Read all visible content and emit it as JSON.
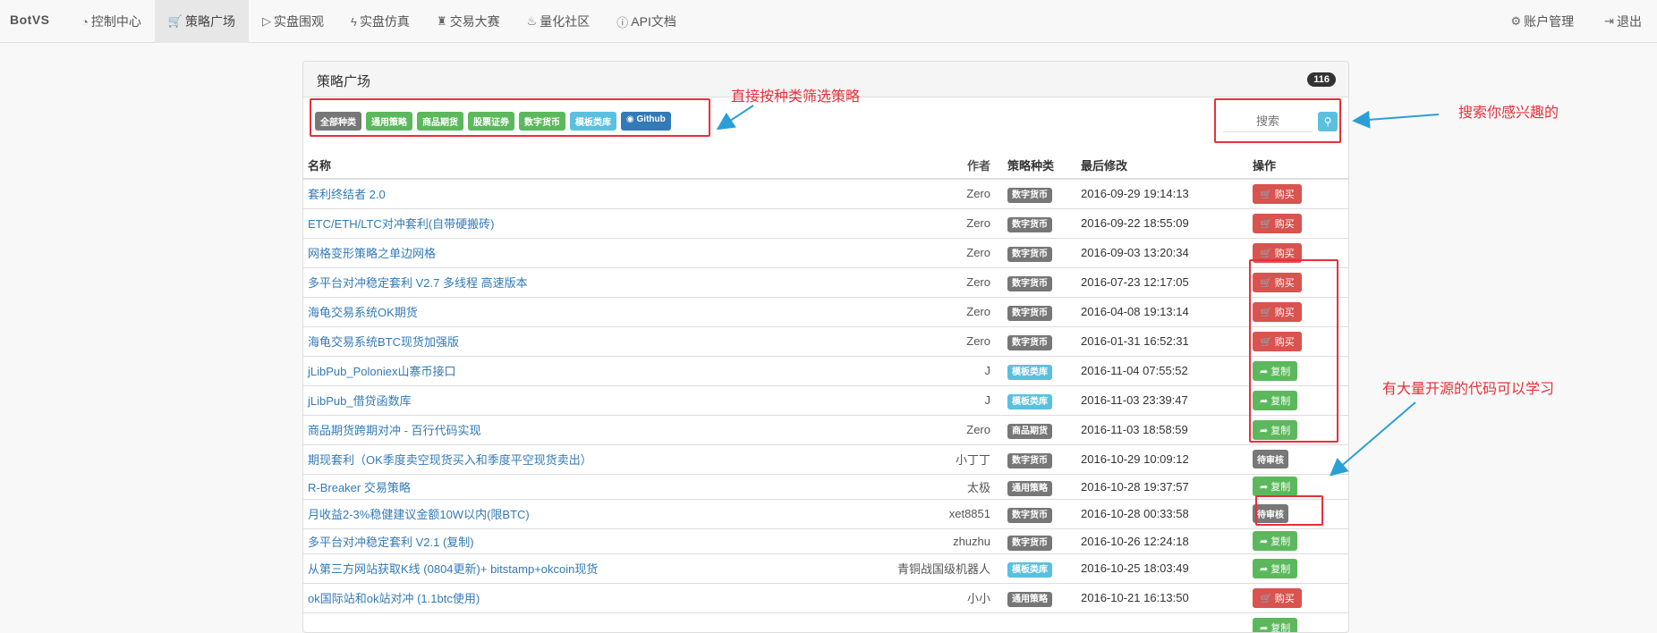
{
  "navbar": {
    "brand": "BotVS",
    "items": [
      {
        "icon": "dashboard-icon",
        "glyph": "◔",
        "label": "控制中心",
        "active": false
      },
      {
        "icon": "cart-icon",
        "glyph": "🛒",
        "label": "策略广场",
        "active": true
      },
      {
        "icon": "play-circle-icon",
        "glyph": "▷",
        "label": "实盘围观",
        "active": false
      },
      {
        "icon": "flash-icon",
        "glyph": "ϟ",
        "label": "实盘仿真",
        "active": false
      },
      {
        "icon": "trophy-icon",
        "glyph": "♜",
        "label": "交易大赛",
        "active": false
      },
      {
        "icon": "fire-icon",
        "glyph": "♨",
        "label": "量化社区",
        "active": false
      },
      {
        "icon": "info-icon",
        "glyph": "ⓘ",
        "label": "API文档",
        "active": false
      }
    ],
    "right_items": [
      {
        "icon": "gear-icon",
        "glyph": "⚙",
        "label": "账户管理"
      },
      {
        "icon": "logout-icon",
        "glyph": "⇥",
        "label": "退出"
      }
    ]
  },
  "panel": {
    "title": "策略广场",
    "count": "116"
  },
  "filters": [
    {
      "label": "全部种类",
      "color": "dark"
    },
    {
      "label": "通用策略",
      "color": "green"
    },
    {
      "label": "商品期货",
      "color": "green"
    },
    {
      "label": "股票证券",
      "color": "green"
    },
    {
      "label": "数字货币",
      "color": "green"
    },
    {
      "label": "模板类库",
      "color": "blue"
    },
    {
      "label": "Github",
      "color": "navy"
    }
  ],
  "search": {
    "placeholder": "搜索"
  },
  "table": {
    "headers": {
      "name": "名称",
      "author": "作者",
      "type": "策略种类",
      "modified": "最后修改",
      "op": "操作"
    },
    "rows": [
      {
        "name": "套利终结者 2.0",
        "author": "Zero",
        "type": "数字货币",
        "type_color": "dark",
        "modified": "2016-09-29 19:14:13",
        "op": "购买",
        "op_kind": "buy"
      },
      {
        "name": "ETC/ETH/LTC对冲套利(自带硬搬砖)",
        "author": "Zero",
        "type": "数字货币",
        "type_color": "dark",
        "modified": "2016-09-22 18:55:09",
        "op": "购买",
        "op_kind": "buy"
      },
      {
        "name": "网格变形策略之单边网格",
        "author": "Zero",
        "type": "数字货币",
        "type_color": "dark",
        "modified": "2016-09-03 13:20:34",
        "op": "购买",
        "op_kind": "buy"
      },
      {
        "name": "多平台对冲稳定套利 V2.7 多线程 高速版本",
        "author": "Zero",
        "type": "数字货币",
        "type_color": "dark",
        "modified": "2016-07-23 12:17:05",
        "op": "购买",
        "op_kind": "buy"
      },
      {
        "name": "海龟交易系统OK期货",
        "author": "Zero",
        "type": "数字货币",
        "type_color": "dark",
        "modified": "2016-04-08 19:13:14",
        "op": "购买",
        "op_kind": "buy"
      },
      {
        "name": "海龟交易系统BTC现货加强版",
        "author": "Zero",
        "type": "数字货币",
        "type_color": "dark",
        "modified": "2016-01-31 16:52:31",
        "op": "购买",
        "op_kind": "buy"
      },
      {
        "name": "jLibPub_Poloniex山寨币接口",
        "author": "J",
        "type": "模板类库",
        "type_color": "blue",
        "modified": "2016-11-04 07:55:52",
        "op": "复制",
        "op_kind": "copy"
      },
      {
        "name": "jLibPub_借贷函数库",
        "author": "J",
        "type": "模板类库",
        "type_color": "blue",
        "modified": "2016-11-03 23:39:47",
        "op": "复制",
        "op_kind": "copy"
      },
      {
        "name": "商品期货跨期对冲 - 百行代码实现",
        "author": "Zero",
        "type": "商品期货",
        "type_color": "dark",
        "modified": "2016-11-03 18:58:59",
        "op": "复制",
        "op_kind": "copy"
      },
      {
        "name": "期现套利（OK季度卖空现货买入和季度平空现货卖出）",
        "author": "小丁丁",
        "type": "数字货币",
        "type_color": "dark",
        "modified": "2016-10-29 10:09:12",
        "op": "待审核",
        "op_kind": "pending"
      },
      {
        "name": "R-Breaker 交易策略",
        "author": "太极",
        "type": "通用策略",
        "type_color": "dark",
        "modified": "2016-10-28 19:37:57",
        "op": "复制",
        "op_kind": "copy"
      },
      {
        "name": "月收益2-3%稳健建议金额10W以内(限BTC)",
        "author": "xet8851",
        "type": "数字货币",
        "type_color": "dark",
        "modified": "2016-10-28 00:33:58",
        "op": "待审核",
        "op_kind": "pending"
      },
      {
        "name": "多平台对冲稳定套利 V2.1 (复制)",
        "author": "zhuzhu",
        "type": "数字货币",
        "type_color": "dark",
        "modified": "2016-10-26 12:24:18",
        "op": "复制",
        "op_kind": "copy"
      },
      {
        "name": "从第三方网站获取K线 (0804更新)+ bitstamp+okcoin现货",
        "author": "青铜战国级机器人",
        "type": "模板类库",
        "type_color": "blue",
        "modified": "2016-10-25 18:03:49",
        "op": "复制",
        "op_kind": "copy"
      },
      {
        "name": "ok国际站和ok站对冲 (1.1btc使用)",
        "author": "小小",
        "type": "通用策略",
        "type_color": "dark",
        "modified": "2016-10-21 16:13:50",
        "op": "购买",
        "op_kind": "buy"
      },
      {
        "name": "",
        "author": "",
        "type": "",
        "type_color": "dark",
        "modified": "",
        "op": "复制",
        "op_kind": "copy"
      }
    ]
  },
  "annotations": {
    "filter_note": "直接按种类筛选策略",
    "search_note": "搜索你感兴趣的",
    "opensource_note": "有大量开源的代码可以学习",
    "color": "#e8303a",
    "arrow_color": "#2a9fd6"
  }
}
